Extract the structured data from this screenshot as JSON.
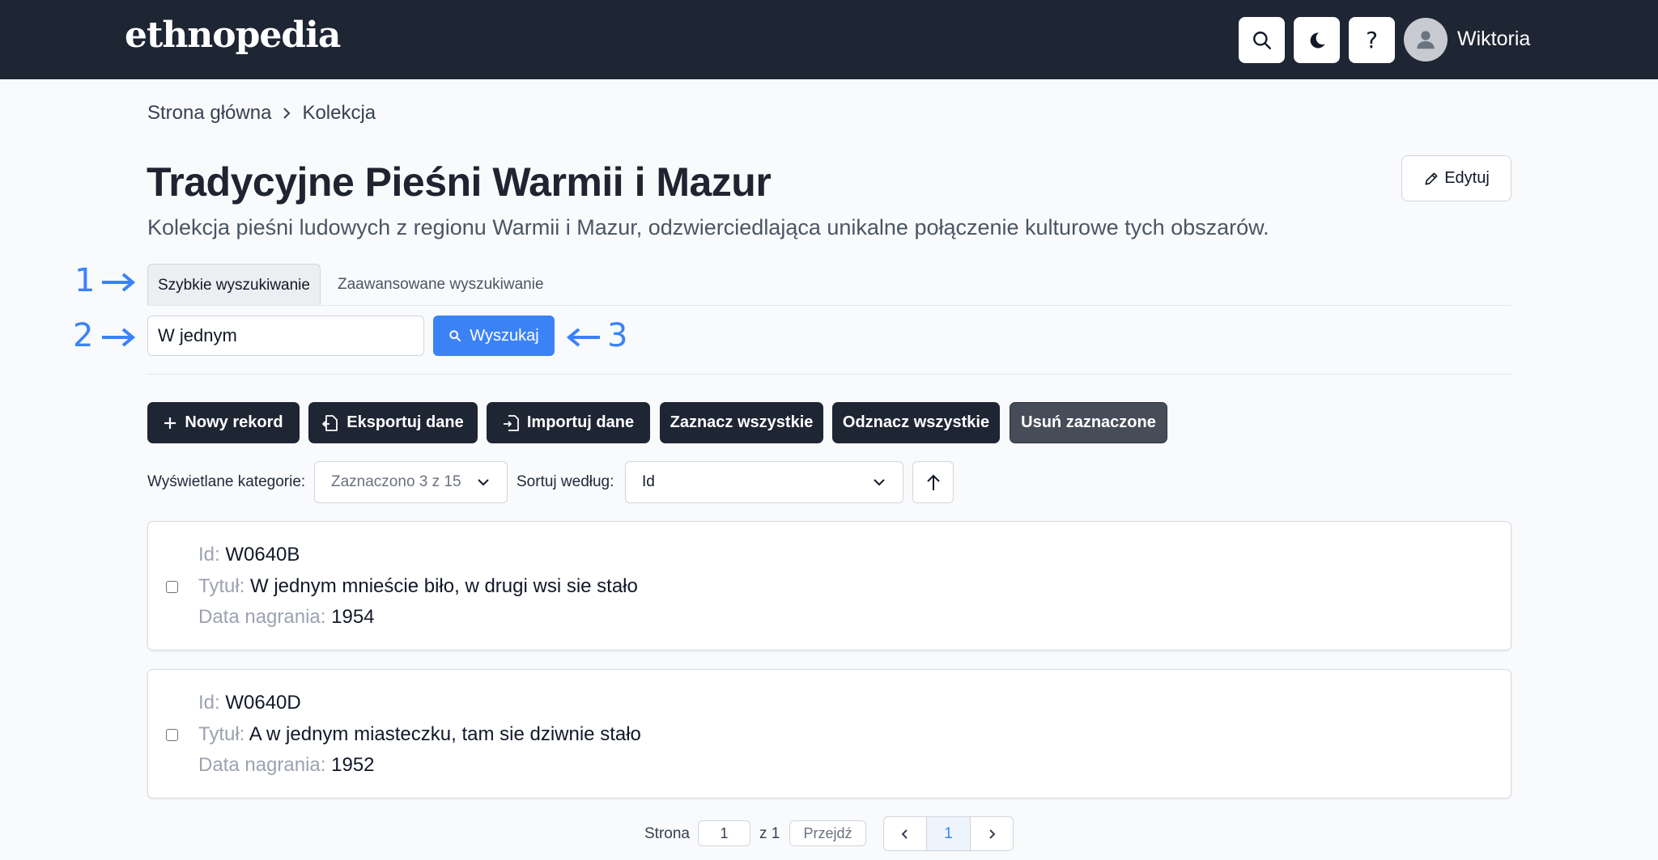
{
  "header": {
    "logo": "ethnopedia",
    "user_name": "Wiktoria",
    "help_label": "?"
  },
  "breadcrumb": [
    "Strona główna",
    "Kolekcja"
  ],
  "collection": {
    "title": "Tradycyjne Pieśni Warmii i Mazur",
    "description": "Kolekcja pieśni ludowych z regionu Warmii i Mazur, odzwierciedlająca unikalne połączenie kulturowe tych obszarów.",
    "edit_label": "Edytuj"
  },
  "annotations": [
    "1",
    "2",
    "3"
  ],
  "tabs": [
    {
      "label": "Szybkie wyszukiwanie",
      "active": true
    },
    {
      "label": "Zaawansowane wyszukiwanie",
      "active": false
    }
  ],
  "search": {
    "value": "W jednym",
    "button_label": "Wyszukaj"
  },
  "toolbar": {
    "new_record": "Nowy rekord",
    "export": "Eksportuj dane",
    "import": "Importuj dane",
    "select_all": "Zaznacz wszystkie",
    "deselect_all": "Odznacz wszystkie",
    "delete_selected": "Usuń zaznaczone"
  },
  "filters": {
    "categories_label": "Wyświetlane kategorie:",
    "categories_value": "Zaznaczono 3 z 15",
    "sort_label": "Sortuj według:",
    "sort_value": "Id"
  },
  "records": [
    {
      "id_label": "Id:",
      "id": "W0640B",
      "title_label": "Tytuł:",
      "title": "W jednym mnieście biło, w drugi wsi sie stało",
      "date_label": "Data nagrania:",
      "date": "1954"
    },
    {
      "id_label": "Id:",
      "id": "W0640D",
      "title_label": "Tytuł:",
      "title": "A w jednym miasteczku, tam sie dziwnie stało",
      "date_label": "Data nagrania:",
      "date": "1952"
    }
  ],
  "pagination": {
    "page_label": "Strona",
    "page_value": "1",
    "of_label": "z 1",
    "go_label": "Przejdź",
    "current_page": "1"
  },
  "colors": {
    "header_bg": "#1e2533",
    "accent": "#3b82f6",
    "annotation": "#3b82f6"
  }
}
